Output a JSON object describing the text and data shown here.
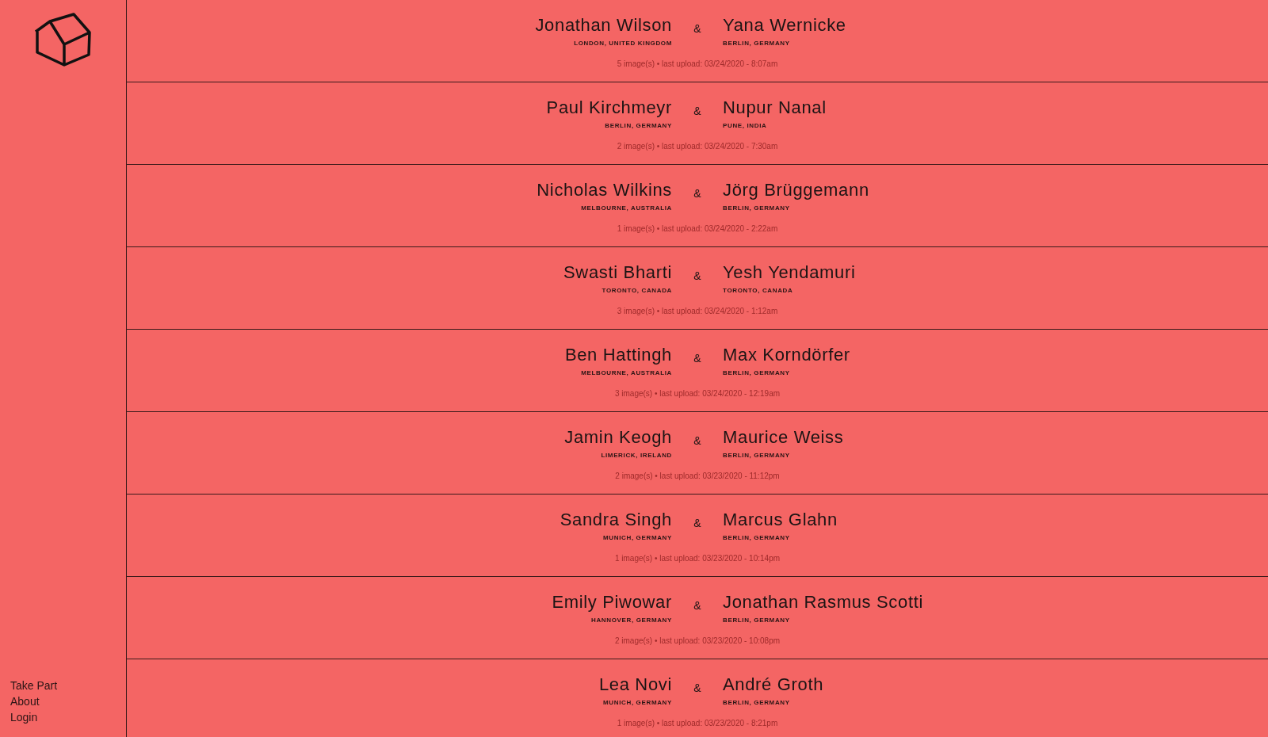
{
  "sidebar": {
    "links": [
      "Take Part",
      "About",
      "Login"
    ]
  },
  "pairs": [
    {
      "left": {
        "name": "Jonathan Wilson",
        "location": "LONDON, UNITED KINGDOM"
      },
      "separator": "&",
      "right": {
        "name": "Yana Wernicke",
        "location": "BERLIN, GERMANY"
      },
      "meta": "5 image(s) • last upload: 03/24/2020 - 8:07am"
    },
    {
      "left": {
        "name": "Paul Kirchmeyr",
        "location": "BERLIN, GERMANY"
      },
      "separator": "&",
      "right": {
        "name": "Nupur Nanal",
        "location": "PUNE, INDIA"
      },
      "meta": "2 image(s) • last upload: 03/24/2020 - 7:30am"
    },
    {
      "left": {
        "name": "Nicholas Wilkins",
        "location": "MELBOURNE, AUSTRALIA"
      },
      "separator": "&",
      "right": {
        "name": "Jörg Brüggemann",
        "location": "BERLIN, GERMANY"
      },
      "meta": "1 image(s) • last upload: 03/24/2020 - 2:22am"
    },
    {
      "left": {
        "name": "Swasti Bharti",
        "location": "TORONTO, CANADA"
      },
      "separator": "&",
      "right": {
        "name": "Yesh Yendamuri",
        "location": "TORONTO, CANADA"
      },
      "meta": "3 image(s) • last upload: 03/24/2020 - 1:12am"
    },
    {
      "left": {
        "name": "Ben Hattingh",
        "location": "MELBOURNE, AUSTRALIA"
      },
      "separator": "&",
      "right": {
        "name": "Max Korndörfer",
        "location": "BERLIN, GERMANY"
      },
      "meta": "3 image(s) • last upload: 03/24/2020 - 12:19am"
    },
    {
      "left": {
        "name": "Jamin Keogh",
        "location": "LIMERICK, IRELAND"
      },
      "separator": "&",
      "right": {
        "name": "Maurice Weiss",
        "location": "BERLIN, GERMANY"
      },
      "meta": "2 image(s) • last upload: 03/23/2020 - 11:12pm"
    },
    {
      "left": {
        "name": "Sandra Singh",
        "location": "MUNICH, GERMANY"
      },
      "separator": "&",
      "right": {
        "name": "Marcus Glahn",
        "location": "BERLIN, GERMANY"
      },
      "meta": "1 image(s) • last upload: 03/23/2020 - 10:14pm"
    },
    {
      "left": {
        "name": "Emily Piwowar",
        "location": "HANNOVER, GERMANY"
      },
      "separator": "&",
      "right": {
        "name": "Jonathan Rasmus Scotti",
        "location": "BERLIN, GERMANY"
      },
      "meta": "2 image(s) • last upload: 03/23/2020 - 10:08pm"
    },
    {
      "left": {
        "name": "Lea Novi",
        "location": "MUNICH, GERMANY"
      },
      "separator": "&",
      "right": {
        "name": "André Groth",
        "location": "BERLIN, GERMANY"
      },
      "meta": "1 image(s) • last upload: 03/23/2020 - 8:21pm"
    }
  ]
}
